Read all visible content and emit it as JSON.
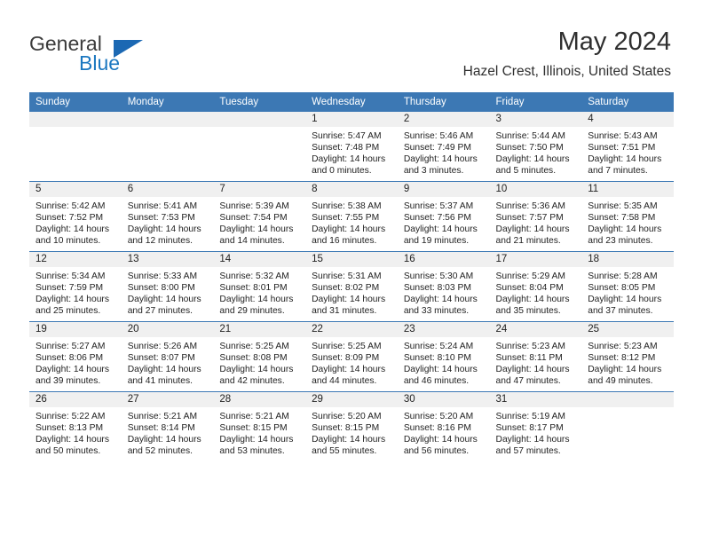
{
  "brand": {
    "word_one": "General",
    "word_two": "Blue",
    "logo_icon": "triangle-flag-icon"
  },
  "header": {
    "title": "May 2024",
    "subtitle": "Hazel Crest, Illinois, United States"
  },
  "calendar": {
    "weekday_headers": [
      "Sunday",
      "Monday",
      "Tuesday",
      "Wednesday",
      "Thursday",
      "Friday",
      "Saturday"
    ],
    "accent_color": "#3c78b4",
    "daynum_background": "#f0f0f0",
    "weeks": [
      [
        {
          "day": "",
          "empty": true
        },
        {
          "day": "",
          "empty": true
        },
        {
          "day": "",
          "empty": true
        },
        {
          "day": "1",
          "sunrise": "Sunrise: 5:47 AM",
          "sunset": "Sunset: 7:48 PM",
          "daylight": "Daylight: 14 hours and 0 minutes."
        },
        {
          "day": "2",
          "sunrise": "Sunrise: 5:46 AM",
          "sunset": "Sunset: 7:49 PM",
          "daylight": "Daylight: 14 hours and 3 minutes."
        },
        {
          "day": "3",
          "sunrise": "Sunrise: 5:44 AM",
          "sunset": "Sunset: 7:50 PM",
          "daylight": "Daylight: 14 hours and 5 minutes."
        },
        {
          "day": "4",
          "sunrise": "Sunrise: 5:43 AM",
          "sunset": "Sunset: 7:51 PM",
          "daylight": "Daylight: 14 hours and 7 minutes."
        }
      ],
      [
        {
          "day": "5",
          "sunrise": "Sunrise: 5:42 AM",
          "sunset": "Sunset: 7:52 PM",
          "daylight": "Daylight: 14 hours and 10 minutes."
        },
        {
          "day": "6",
          "sunrise": "Sunrise: 5:41 AM",
          "sunset": "Sunset: 7:53 PM",
          "daylight": "Daylight: 14 hours and 12 minutes."
        },
        {
          "day": "7",
          "sunrise": "Sunrise: 5:39 AM",
          "sunset": "Sunset: 7:54 PM",
          "daylight": "Daylight: 14 hours and 14 minutes."
        },
        {
          "day": "8",
          "sunrise": "Sunrise: 5:38 AM",
          "sunset": "Sunset: 7:55 PM",
          "daylight": "Daylight: 14 hours and 16 minutes."
        },
        {
          "day": "9",
          "sunrise": "Sunrise: 5:37 AM",
          "sunset": "Sunset: 7:56 PM",
          "daylight": "Daylight: 14 hours and 19 minutes."
        },
        {
          "day": "10",
          "sunrise": "Sunrise: 5:36 AM",
          "sunset": "Sunset: 7:57 PM",
          "daylight": "Daylight: 14 hours and 21 minutes."
        },
        {
          "day": "11",
          "sunrise": "Sunrise: 5:35 AM",
          "sunset": "Sunset: 7:58 PM",
          "daylight": "Daylight: 14 hours and 23 minutes."
        }
      ],
      [
        {
          "day": "12",
          "sunrise": "Sunrise: 5:34 AM",
          "sunset": "Sunset: 7:59 PM",
          "daylight": "Daylight: 14 hours and 25 minutes."
        },
        {
          "day": "13",
          "sunrise": "Sunrise: 5:33 AM",
          "sunset": "Sunset: 8:00 PM",
          "daylight": "Daylight: 14 hours and 27 minutes."
        },
        {
          "day": "14",
          "sunrise": "Sunrise: 5:32 AM",
          "sunset": "Sunset: 8:01 PM",
          "daylight": "Daylight: 14 hours and 29 minutes."
        },
        {
          "day": "15",
          "sunrise": "Sunrise: 5:31 AM",
          "sunset": "Sunset: 8:02 PM",
          "daylight": "Daylight: 14 hours and 31 minutes."
        },
        {
          "day": "16",
          "sunrise": "Sunrise: 5:30 AM",
          "sunset": "Sunset: 8:03 PM",
          "daylight": "Daylight: 14 hours and 33 minutes."
        },
        {
          "day": "17",
          "sunrise": "Sunrise: 5:29 AM",
          "sunset": "Sunset: 8:04 PM",
          "daylight": "Daylight: 14 hours and 35 minutes."
        },
        {
          "day": "18",
          "sunrise": "Sunrise: 5:28 AM",
          "sunset": "Sunset: 8:05 PM",
          "daylight": "Daylight: 14 hours and 37 minutes."
        }
      ],
      [
        {
          "day": "19",
          "sunrise": "Sunrise: 5:27 AM",
          "sunset": "Sunset: 8:06 PM",
          "daylight": "Daylight: 14 hours and 39 minutes."
        },
        {
          "day": "20",
          "sunrise": "Sunrise: 5:26 AM",
          "sunset": "Sunset: 8:07 PM",
          "daylight": "Daylight: 14 hours and 41 minutes."
        },
        {
          "day": "21",
          "sunrise": "Sunrise: 5:25 AM",
          "sunset": "Sunset: 8:08 PM",
          "daylight": "Daylight: 14 hours and 42 minutes."
        },
        {
          "day": "22",
          "sunrise": "Sunrise: 5:25 AM",
          "sunset": "Sunset: 8:09 PM",
          "daylight": "Daylight: 14 hours and 44 minutes."
        },
        {
          "day": "23",
          "sunrise": "Sunrise: 5:24 AM",
          "sunset": "Sunset: 8:10 PM",
          "daylight": "Daylight: 14 hours and 46 minutes."
        },
        {
          "day": "24",
          "sunrise": "Sunrise: 5:23 AM",
          "sunset": "Sunset: 8:11 PM",
          "daylight": "Daylight: 14 hours and 47 minutes."
        },
        {
          "day": "25",
          "sunrise": "Sunrise: 5:23 AM",
          "sunset": "Sunset: 8:12 PM",
          "daylight": "Daylight: 14 hours and 49 minutes."
        }
      ],
      [
        {
          "day": "26",
          "sunrise": "Sunrise: 5:22 AM",
          "sunset": "Sunset: 8:13 PM",
          "daylight": "Daylight: 14 hours and 50 minutes."
        },
        {
          "day": "27",
          "sunrise": "Sunrise: 5:21 AM",
          "sunset": "Sunset: 8:14 PM",
          "daylight": "Daylight: 14 hours and 52 minutes."
        },
        {
          "day": "28",
          "sunrise": "Sunrise: 5:21 AM",
          "sunset": "Sunset: 8:15 PM",
          "daylight": "Daylight: 14 hours and 53 minutes."
        },
        {
          "day": "29",
          "sunrise": "Sunrise: 5:20 AM",
          "sunset": "Sunset: 8:15 PM",
          "daylight": "Daylight: 14 hours and 55 minutes."
        },
        {
          "day": "30",
          "sunrise": "Sunrise: 5:20 AM",
          "sunset": "Sunset: 8:16 PM",
          "daylight": "Daylight: 14 hours and 56 minutes."
        },
        {
          "day": "31",
          "sunrise": "Sunrise: 5:19 AM",
          "sunset": "Sunset: 8:17 PM",
          "daylight": "Daylight: 14 hours and 57 minutes."
        },
        {
          "day": "",
          "empty": true
        }
      ]
    ]
  }
}
